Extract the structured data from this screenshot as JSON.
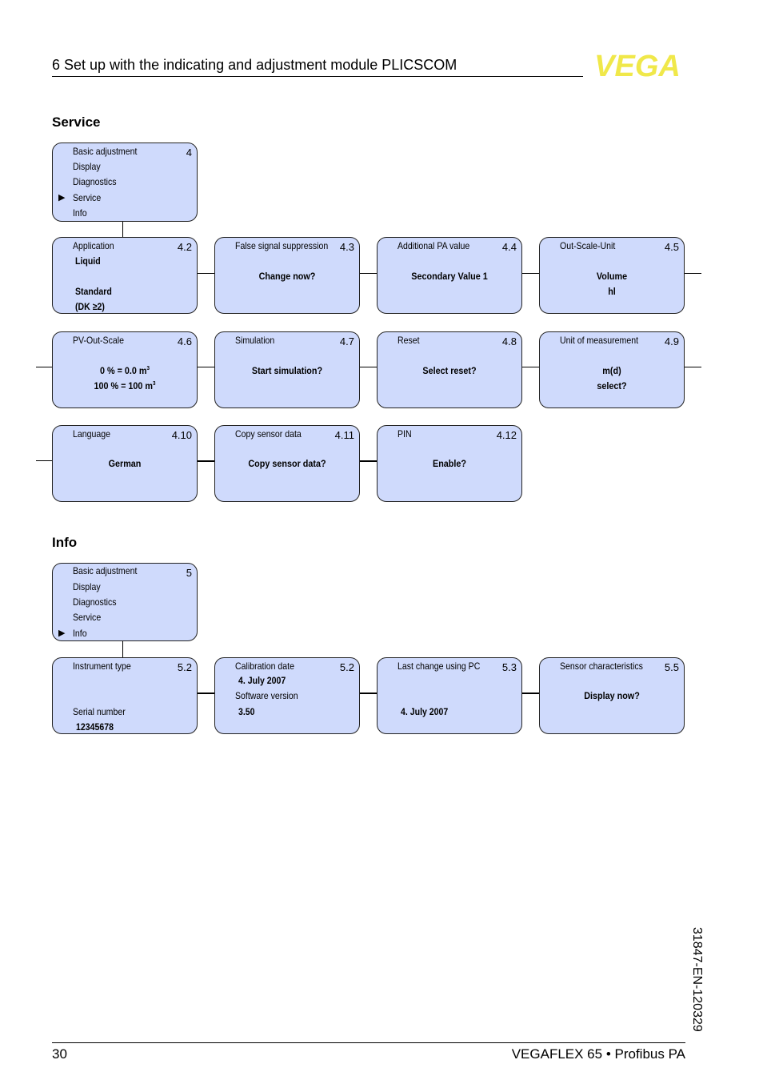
{
  "header": {
    "chapter_title": "6   Set up with the indicating and adjustment module PLICSCOM",
    "logo_text": "VEGA",
    "logo_color": "#f0e84a"
  },
  "service": {
    "heading": "Service",
    "menu": {
      "items": [
        "Basic adjustment",
        "Display",
        "Diagnostics",
        "Service",
        "Info"
      ],
      "selected": "Service",
      "number": "4",
      "pointer_icon": "triangle-right"
    },
    "boxes": [
      {
        "title": "Application",
        "num": "4.2",
        "values": [
          "Liquid",
          "Standard",
          "(DK ≥2)"
        ]
      },
      {
        "title": "False signal suppression",
        "num": "4.3",
        "values": [
          "Change now?"
        ]
      },
      {
        "title": "Additional PA value",
        "num": "4.4",
        "values": [
          "Secondary Value 1"
        ]
      },
      {
        "title": "Out-Scale-Unit",
        "num": "4.5",
        "values": [
          "Volume",
          "hl"
        ]
      },
      {
        "title": "PV-Out-Scale",
        "num": "4.6",
        "values": [
          "0 % = 0.0 m",
          "100 % = 100 m"
        ],
        "superscript": "3"
      },
      {
        "title": "Simulation",
        "num": "4.7",
        "values": [
          "Start simulation?"
        ]
      },
      {
        "title": "Reset",
        "num": "4.8",
        "values": [
          "Select reset?"
        ]
      },
      {
        "title": "Unit of measurement",
        "num": "4.9",
        "values": [
          "m(d)",
          "select?"
        ]
      },
      {
        "title": "Language",
        "num": "4.10",
        "values": [
          "German"
        ]
      },
      {
        "title": "Copy sensor data",
        "num": "4.11",
        "values": [
          "Copy sensor data?"
        ]
      },
      {
        "title": "PIN",
        "num": "4.12",
        "values": [
          "Enable?"
        ]
      }
    ]
  },
  "info": {
    "heading": "Info",
    "menu": {
      "items": [
        "Basic adjustment",
        "Display",
        "Diagnostics",
        "Service",
        "Info"
      ],
      "selected": "Info",
      "number": "5"
    },
    "boxes": [
      {
        "title": "Instrument type",
        "num": "5.2",
        "label2": "Serial number",
        "value2": "12345678"
      },
      {
        "title": "Calibration date",
        "num": "5.2",
        "value1": "4. July 2007",
        "label2": "Software version",
        "value2": "3.50"
      },
      {
        "title": "Last change using PC",
        "num": "5.3",
        "value1": "4. July 2007"
      },
      {
        "title": "Sensor characteristics",
        "num": "5.5",
        "value1": "Display now?"
      }
    ]
  },
  "footer": {
    "page_number": "30",
    "product": "VEGAFLEX 65 • Profibus PA",
    "doc_id": "31847-EN-120329"
  },
  "colors": {
    "box_fill": "#cfdafc",
    "border": "#222222"
  }
}
